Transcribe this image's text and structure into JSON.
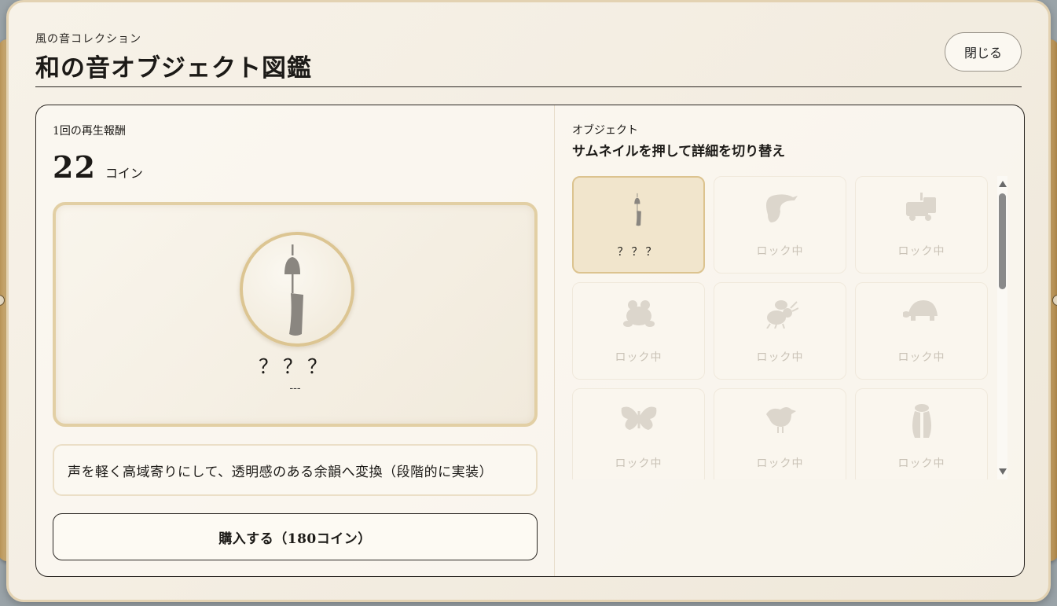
{
  "header": {
    "subtitle": "風の音コレクション",
    "title": "和の音オブジェクト図鑑",
    "close_label": "閉じる"
  },
  "reward": {
    "label": "1回の再生報酬",
    "value": "22",
    "unit": "コイン"
  },
  "preview": {
    "icon": "wind-chime-icon",
    "name": "？？？",
    "sub": "---"
  },
  "description": "声を軽く高域寄りにして、透明感のある余韻へ変換（段階的に実装）",
  "buy_label": "購入する（180コイン）",
  "objects": {
    "label": "オブジェクト",
    "hint": "サムネイルを押して詳細を切り替え",
    "items": [
      {
        "icon": "wind-chime-icon",
        "label": "？？？",
        "selected": true
      },
      {
        "icon": "crane-icon",
        "label": "ロック中"
      },
      {
        "icon": "cart-icon",
        "label": "ロック中"
      },
      {
        "icon": "frog-icon",
        "label": "ロック中"
      },
      {
        "icon": "bee-icon",
        "label": "ロック中"
      },
      {
        "icon": "turtle-icon",
        "label": "ロック中"
      },
      {
        "icon": "butterfly-icon",
        "label": "ロック中"
      },
      {
        "icon": "bird-icon",
        "label": "ロック中"
      },
      {
        "icon": "cicada-icon",
        "label": "ロック中"
      }
    ]
  },
  "colors": {
    "accent_gold": "#dcc38f",
    "locked_silhouette": "#dcd6cc",
    "unlocked_silhouette": "#8a8680"
  }
}
